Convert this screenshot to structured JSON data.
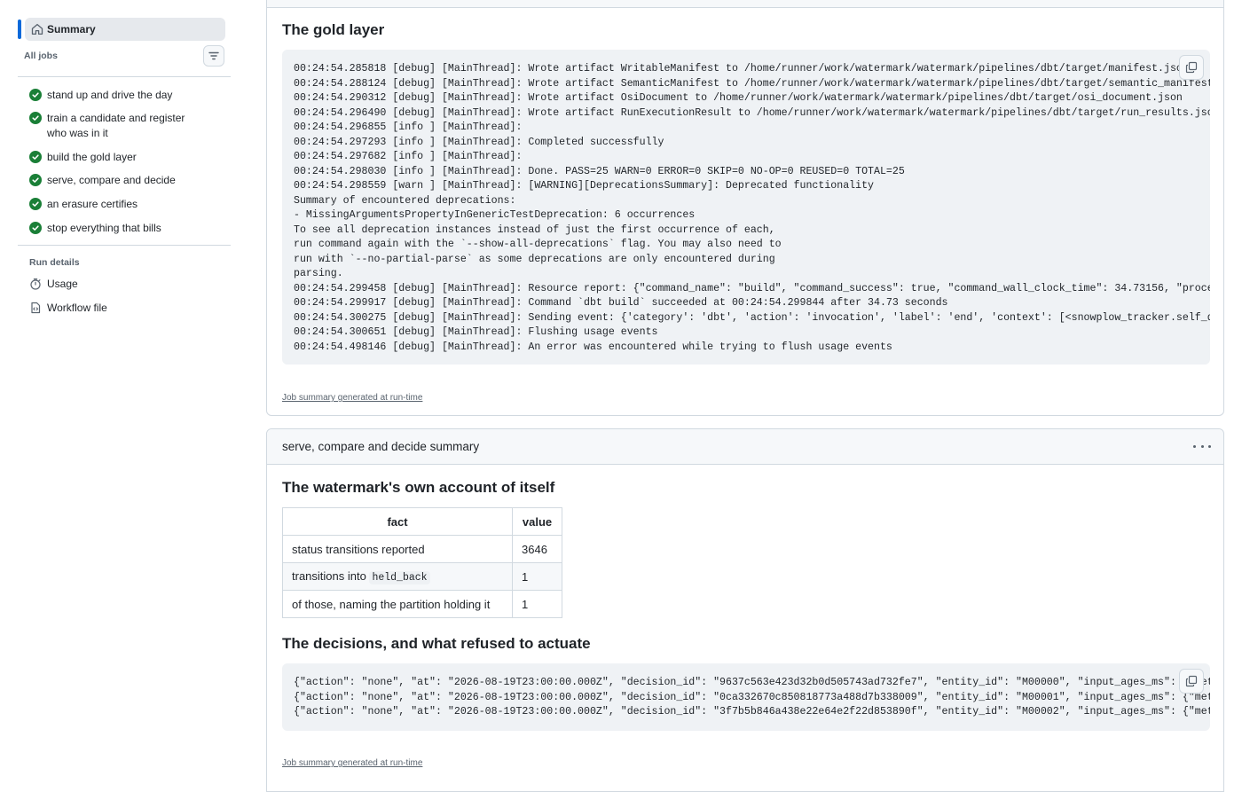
{
  "sidebar": {
    "summary_label": "Summary",
    "all_jobs_label": "All jobs",
    "jobs": [
      {
        "label": "stand up and drive the day",
        "status": "success"
      },
      {
        "label": "train a candidate and register who was in it",
        "status": "success"
      },
      {
        "label": "build the gold layer",
        "status": "success"
      },
      {
        "label": "serve, compare and decide",
        "status": "success"
      },
      {
        "label": "an erasure certifies",
        "status": "success"
      },
      {
        "label": "stop everything that bills",
        "status": "success"
      }
    ],
    "run_details_label": "Run details",
    "details": [
      {
        "label": "Usage",
        "icon": "stopwatch-icon"
      },
      {
        "label": "Workflow file",
        "icon": "file-code-icon"
      }
    ]
  },
  "gold_layer": {
    "heading": "The gold layer",
    "log": "00:24:54.285818 [debug] [MainThread]: Wrote artifact WritableManifest to /home/runner/work/watermark/watermark/pipelines/dbt/target/manifest.json\n00:24:54.288124 [debug] [MainThread]: Wrote artifact SemanticManifest to /home/runner/work/watermark/watermark/pipelines/dbt/target/semantic_manifest.json\n00:24:54.290312 [debug] [MainThread]: Wrote artifact OsiDocument to /home/runner/work/watermark/watermark/pipelines/dbt/target/osi_document.json\n00:24:54.296490 [debug] [MainThread]: Wrote artifact RunExecutionResult to /home/runner/work/watermark/watermark/pipelines/dbt/target/run_results.json\n00:24:54.296855 [info ] [MainThread]:\n00:24:54.297293 [info ] [MainThread]: Completed successfully\n00:24:54.297682 [info ] [MainThread]:\n00:24:54.298030 [info ] [MainThread]: Done. PASS=25 WARN=0 ERROR=0 SKIP=0 NO-OP=0 REUSED=0 TOTAL=25\n00:24:54.298559 [warn ] [MainThread]: [WARNING][DeprecationsSummary]: Deprecated functionality\nSummary of encountered deprecations:\n- MissingArgumentsPropertyInGenericTestDeprecation: 6 occurrences\nTo see all deprecation instances instead of just the first occurrence of each,\nrun command again with the `--show-all-deprecations` flag. You may also need to\nrun with `--no-partial-parse` as some deprecations are only encountered during\nparsing.\n00:24:54.299458 [debug] [MainThread]: Resource report: {\"command_name\": \"build\", \"command_success\": true, \"command_wall_clock_time\": 34.73156, \"process_\n00:24:54.299917 [debug] [MainThread]: Command `dbt build` succeeded at 00:24:54.299844 after 34.73 seconds\n00:24:54.300275 [debug] [MainThread]: Sending event: {'category': 'dbt', 'action': 'invocation', 'label': 'end', 'context': [<snowplow_tracker.self_desc\n00:24:54.300651 [debug] [MainThread]: Flushing usage events\n00:24:54.498146 [debug] [MainThread]: An error was encountered while trying to flush usage events",
    "footer": "Job summary generated at run-time"
  },
  "serve_summary": {
    "header_title": "serve, compare and decide summary",
    "heading_account": "The watermark's own account of itself",
    "table": {
      "headers": [
        "fact",
        "value"
      ],
      "rows": [
        {
          "fact": "status transitions reported",
          "value": "3646"
        },
        {
          "fact_prefix": "transitions into",
          "fact_code": "held_back",
          "value": "1"
        },
        {
          "fact": "of those, naming the partition holding it",
          "value": "1"
        }
      ]
    },
    "heading_decisions": "The decisions, and what refused to actuate",
    "decisions": "{\"action\": \"none\", \"at\": \"2026-08-19T23:00:00.000Z\", \"decision_id\": \"9637c563e423d32b0d505743ad732fe7\", \"entity_id\": \"M00000\", \"input_ages_ms\": {\"meter_\n{\"action\": \"none\", \"at\": \"2026-08-19T23:00:00.000Z\", \"decision_id\": \"0ca332670c850818773a488d7b338009\", \"entity_id\": \"M00001\", \"input_ages_ms\": {\"meter_\n{\"action\": \"none\", \"at\": \"2026-08-19T23:00:00.000Z\", \"decision_id\": \"3f7b5b846a438e22e64e2f22d853890f\", \"entity_id\": \"M00002\", \"input_ages_ms\": {\"meter_",
    "footer": "Job summary generated at run-time"
  }
}
